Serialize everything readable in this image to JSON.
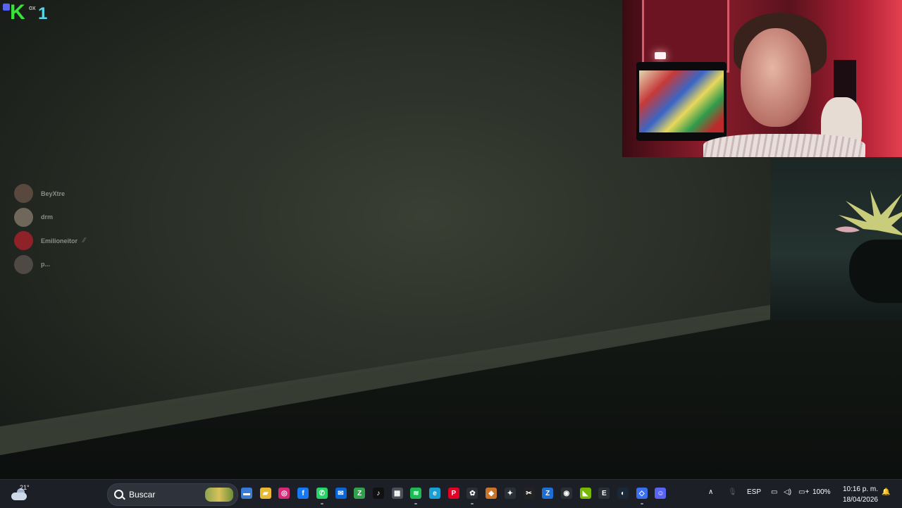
{
  "overlay_logo": {
    "app_letter": "K",
    "suffix": "1",
    "label": "ox"
  },
  "voice_users": [
    {
      "name": "BeyXtre",
      "avatar_color": "#6b5448",
      "muted": false
    },
    {
      "name": "drm",
      "avatar_color": "#8a7d6e",
      "muted": false
    },
    {
      "name": "Emilioneitor",
      "avatar_color": "#b3222c",
      "muted": true
    },
    {
      "name": "p...",
      "avatar_color": "#5d5650",
      "muted": false
    }
  ],
  "voice_mute_icon": "⁄⁄",
  "taskbar": {
    "weather_temp": "21°",
    "search_placeholder": "Buscar",
    "apps": [
      {
        "name": "widget-icon",
        "glyph": "▬",
        "color": "#3a7bd5"
      },
      {
        "name": "file-explorer-icon",
        "glyph": "▰",
        "color": "#e8b931"
      },
      {
        "name": "instagram-icon",
        "glyph": "◎",
        "color": "#d62976"
      },
      {
        "name": "facebook-icon",
        "glyph": "f",
        "color": "#1877f2"
      },
      {
        "name": "whatsapp-icon",
        "glyph": "✆",
        "color": "#25d366"
      },
      {
        "name": "mail-icon",
        "glyph": "✉",
        "color": "#0a64d6"
      },
      {
        "name": "editor-icon",
        "glyph": "Z",
        "color": "#31a24c"
      },
      {
        "name": "tiktok-icon",
        "glyph": "♪",
        "color": "#111111"
      },
      {
        "name": "store-icon",
        "glyph": "▦",
        "color": "#4a4f5a"
      },
      {
        "name": "spotify-icon",
        "glyph": "≋",
        "color": "#1db954"
      },
      {
        "name": "edge-icon",
        "glyph": "e",
        "color": "#1a9fd4"
      },
      {
        "name": "pinterest-icon",
        "glyph": "P",
        "color": "#e60023"
      },
      {
        "name": "chatgpt-icon",
        "glyph": "✿",
        "color": "#2b2f36"
      },
      {
        "name": "shield-icon",
        "glyph": "◆",
        "color": "#c8742b"
      },
      {
        "name": "obs-icon",
        "glyph": "✦",
        "color": "#2b2f36"
      },
      {
        "name": "capcut-icon",
        "glyph": "✂",
        "color": "#222222"
      },
      {
        "name": "zed-icon",
        "glyph": "Z",
        "color": "#1d6fd6"
      },
      {
        "name": "app-icon",
        "glyph": "◉",
        "color": "#2b2f36"
      },
      {
        "name": "nvidia-icon",
        "glyph": "◣",
        "color": "#76b900"
      },
      {
        "name": "epic-icon",
        "glyph": "E",
        "color": "#2b2f36"
      },
      {
        "name": "steam-icon",
        "glyph": "◐",
        "color": "#1b2838"
      },
      {
        "name": "roblox-icon",
        "glyph": "◇",
        "color": "#3b6ff0"
      },
      {
        "name": "discord-icon",
        "glyph": "☺",
        "color": "#5865f2"
      }
    ],
    "tray_language": "ESP",
    "battery": "100%",
    "time": "10:16 p. m.",
    "date": "18/04/2026"
  }
}
